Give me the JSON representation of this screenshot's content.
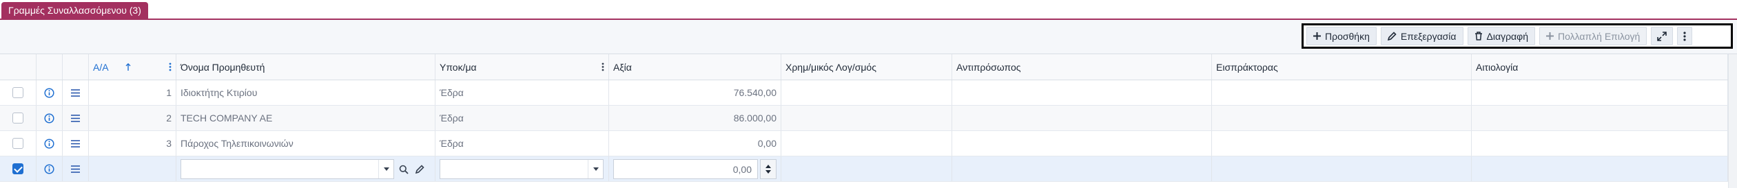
{
  "tab": {
    "label": "Γραμμές Συναλλασσόμενου (3)"
  },
  "toolbar": {
    "add_label": "Προσθήκη",
    "edit_label": "Επεξεργασία",
    "delete_label": "Διαγραφή",
    "multi_label": "Πολλαπλή Επιλογή"
  },
  "columns": {
    "aa": "Α/Α",
    "supplier": "Όνομα Προμηθευτή",
    "branch": "Υποκ/μα",
    "value": "Αξία",
    "account": "Χρημ/μικός Λογ/σμός",
    "representative": "Αντιπρόσωπος",
    "collector": "Εισπράκτορας",
    "reason": "Αιτιολογία"
  },
  "rows": [
    {
      "aa": "1",
      "supplier": "Ιδιοκτήτης Κτιρίου",
      "branch": "Έδρα",
      "value": "76.540,00"
    },
    {
      "aa": "2",
      "supplier": "TECH COMPANY AE",
      "branch": "Έδρα",
      "value": "86.000,00"
    },
    {
      "aa": "3",
      "supplier": "Πάροχος Τηλεπικοινωνιών",
      "branch": "Έδρα",
      "value": "0,00"
    }
  ],
  "new_row": {
    "value": "0,00",
    "checked": true
  },
  "colors": {
    "tab": "#a3305f",
    "accent": "#1f6fd1"
  }
}
